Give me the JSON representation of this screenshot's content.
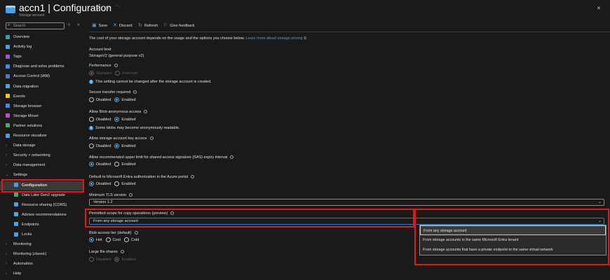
{
  "header": {
    "title": "accn1 | Configuration",
    "subtitle": "Storage account",
    "close": "✕"
  },
  "search": {
    "placeholder": "Search"
  },
  "sidebar": {
    "items": [
      {
        "label": "Overview",
        "icon": "overview-icon",
        "color": "#3aa0a0"
      },
      {
        "label": "Activity log",
        "icon": "activity-log-icon",
        "color": "#4aa0e6"
      },
      {
        "label": "Tags",
        "icon": "tags-icon",
        "color": "#9b59d0"
      },
      {
        "label": "Diagnose and solve problems",
        "icon": "diagnose-icon",
        "color": "#3a8ee6"
      },
      {
        "label": "Access Control (IAM)",
        "icon": "iam-icon",
        "color": "#5577cc"
      },
      {
        "label": "Data migration",
        "icon": "data-migration-icon",
        "color": "#44b0d8"
      },
      {
        "label": "Events",
        "icon": "events-icon",
        "color": "#f2c811"
      },
      {
        "label": "Storage browser",
        "icon": "storage-browser-icon",
        "color": "#3a8ee6"
      },
      {
        "label": "Storage Mover",
        "icon": "storage-mover-icon",
        "color": "#c050c0"
      },
      {
        "label": "Partner solutions",
        "icon": "partner-icon",
        "color": "#40b060"
      },
      {
        "label": "Resource visualizer",
        "icon": "resource-visualizer-icon",
        "color": "#4aa0e6"
      },
      {
        "label": "Data storage",
        "group": true
      },
      {
        "label": "Security + networking",
        "group": true
      },
      {
        "label": "Data management",
        "group": true
      },
      {
        "label": "Settings",
        "group": true,
        "open": true
      },
      {
        "label": "Configuration",
        "icon": "configuration-icon",
        "color": "#4aa0e6",
        "sub": true,
        "selected": true
      },
      {
        "label": "Data Lake Gen2 upgrade",
        "icon": "data-lake-icon",
        "color": "#40b060",
        "sub": true
      },
      {
        "label": "Resource sharing (CORS)",
        "icon": "cors-icon",
        "color": "#4aa0e6",
        "sub": true
      },
      {
        "label": "Advisor recommendations",
        "icon": "advisor-icon",
        "color": "#44b0d8",
        "sub": true
      },
      {
        "label": "Endpoints",
        "icon": "endpoints-icon",
        "color": "#4aa0e6",
        "sub": true
      },
      {
        "label": "Locks",
        "icon": "locks-icon",
        "color": "#4aa0e6",
        "sub": true
      },
      {
        "label": "Monitoring",
        "group": true
      },
      {
        "label": "Monitoring (classic)",
        "group": true
      },
      {
        "label": "Automation",
        "group": true
      },
      {
        "label": "Help",
        "group": true
      }
    ]
  },
  "toolbar": {
    "save": "Save",
    "discard": "Discard",
    "refresh": "Refresh",
    "feedback": "Give feedback"
  },
  "content": {
    "intro": "The cost of your storage account depends on the usage and the options you choose below.",
    "intro_link": "Learn more about storage pricing",
    "account_kind_label": "Account kind",
    "account_kind_value": "StorageV2 (general purpose v2)",
    "perf_info": "This setting cannot be changed after the storage account is created.",
    "blob_info": "Some blobs may become anonymously readable.",
    "tls_label": "Minimum TLS version",
    "tls_value": "Version 1.2",
    "scope_label": "Permitted scope for copy operations (preview)",
    "scope_value": "From any storage account",
    "scope_options": [
      "From any storage account",
      "From storage accounts in the same Microsoft Entra tenant",
      "From storage accounts that have a private endpoint to the same virtual network"
    ],
    "radios": [
      {
        "label": "Performance",
        "options": [
          "Standard",
          "Premium"
        ],
        "selected": 0,
        "disabled": true
      },
      {
        "label": "Secure transfer required",
        "options": [
          "Disabled",
          "Enabled"
        ],
        "selected": 1
      },
      {
        "label": "Allow Blob anonymous access",
        "options": [
          "Disabled",
          "Enabled"
        ],
        "selected": 1
      },
      {
        "label": "Allow storage account key access",
        "options": [
          "Disabled",
          "Enabled"
        ],
        "selected": 1
      },
      {
        "label": "Allow recommended upper limit for shared access signature (SAS) expiry interval",
        "options": [
          "Disabled",
          "Enabled"
        ],
        "selected": 0
      },
      {
        "label": "Default to Microsoft Entra authorization in the Azure portal",
        "options": [
          "Disabled",
          "Enabled"
        ],
        "selected": 0
      },
      {
        "label": "Blob access tier (default)",
        "options": [
          "Hot",
          "Cool",
          "Cold"
        ],
        "selected": 0
      },
      {
        "label": "Large file shares",
        "options": [
          "Disabled",
          "Enabled"
        ],
        "selected": 1,
        "disabled": true
      }
    ]
  }
}
